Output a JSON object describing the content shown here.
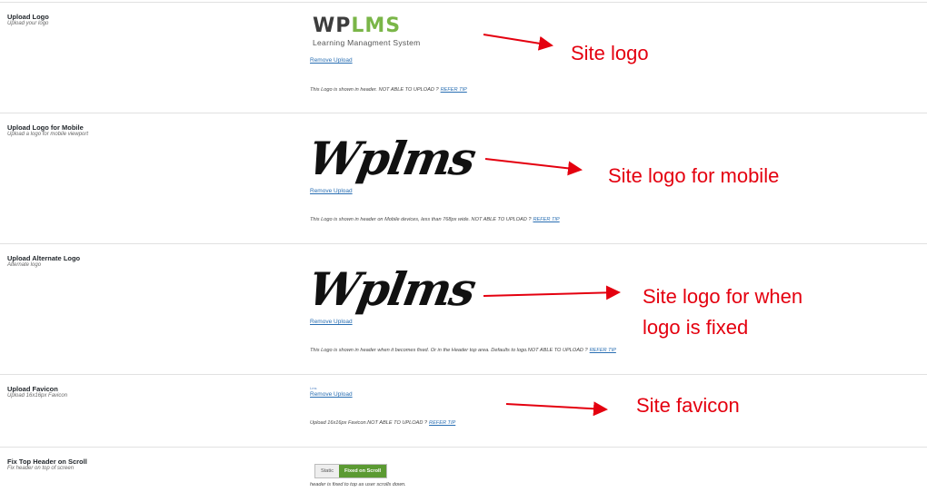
{
  "rows": {
    "logo": {
      "label": "Upload Logo",
      "desc": "Upload your logo",
      "logo_prefix": "WP",
      "logo_suffix": "LMS",
      "logo_tagline": "Learning Managment System",
      "remove": "Remove Upload",
      "note": "This Logo is shown in header. NOT ABLE TO UPLOAD ?",
      "tip": "REFER TIP"
    },
    "mobile": {
      "label": "Upload Logo for Mobile",
      "desc": "Upload a logo for mobile viewport",
      "logo_text": "Wplms",
      "remove": "Remove Upload",
      "note": "This Logo is shown in header on Mobile devices, less than 768px wide. NOT ABLE TO UPLOAD ?",
      "tip": "REFER TIP"
    },
    "alternate": {
      "label": "Upload Alternate Logo",
      "desc": "Alternate logo",
      "logo_text": "Wplms",
      "remove": "Remove Upload",
      "note": "This Logo is shown in header when it becomes fixed. Or in the Header top area. Defaults to logo.NOT ABLE TO UPLOAD ?",
      "tip": "REFER TIP"
    },
    "favicon": {
      "label": "Upload Favicon",
      "desc": "Upload 16x16px Favicon",
      "image_text": "Lms",
      "remove": "Remove Upload",
      "note": "Upload 16x16px Favicon.NOT ABLE TO UPLOAD ?",
      "tip": "REFER TIP"
    },
    "fixed_header": {
      "label": "Fix Top Header on Scroll",
      "desc": "Fix header on top of screen",
      "option_static": "Static",
      "option_fixed": "Fixed on Scroll",
      "selected": "Fixed on Scroll",
      "note": "header is fixed to top as user scrolls down."
    }
  },
  "annotations": {
    "site_logo": "Site logo",
    "site_logo_mobile": "Site logo for mobile",
    "fixed_line1": "Site logo for when",
    "fixed_line2": "logo is fixed",
    "favicon": "Site favicon"
  },
  "colors": {
    "annotation": "#e4000f",
    "link": "#2a6fb3",
    "brand_green": "#7ab648",
    "toggle_active": "#5b9a32"
  }
}
